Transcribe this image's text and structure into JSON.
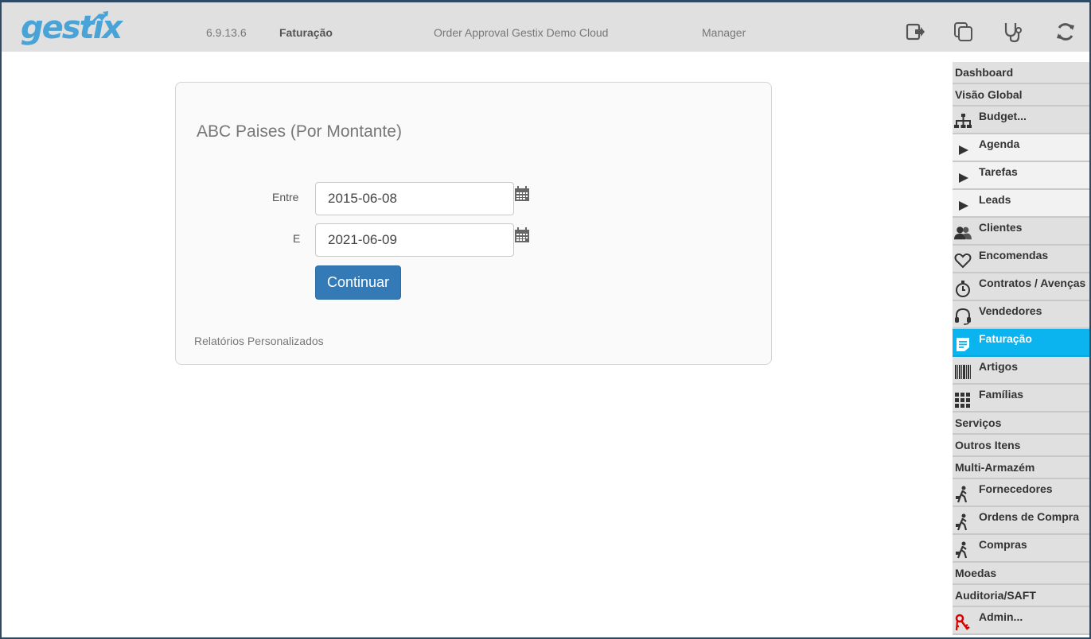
{
  "header": {
    "logo_text": "gestix",
    "version": "6.9.13.6",
    "module": "Faturação",
    "company": "Order Approval Gestix Demo Cloud",
    "role": "Manager",
    "icons": [
      "logout-icon",
      "copy-icon",
      "stethoscope-icon",
      "refresh-icon"
    ]
  },
  "report": {
    "title": "ABC Paises (Por Montante)",
    "from_label": "Entre",
    "from_value": "2015-06-08",
    "to_label": "E",
    "to_value": "2021-06-09",
    "submit_label": "Continuar",
    "footer_link": "Relatórios Personalizados"
  },
  "sidebar": {
    "items": [
      {
        "label": "Dashboard",
        "icon": ""
      },
      {
        "label": "Visão Global",
        "icon": ""
      },
      {
        "label": "Budget...",
        "icon": "org-chart-icon"
      },
      {
        "label": "Agenda",
        "icon": "play-icon"
      },
      {
        "label": "Tarefas",
        "icon": "play-icon"
      },
      {
        "label": "Leads",
        "icon": "play-icon"
      },
      {
        "label": "Clientes",
        "icon": "users-icon"
      },
      {
        "label": "Encomendas",
        "icon": "heart-icon"
      },
      {
        "label": "Contratos / Avenças",
        "icon": "stopwatch-icon"
      },
      {
        "label": "Vendedores",
        "icon": "headset-icon"
      },
      {
        "label": "Faturação",
        "icon": "invoice-icon"
      },
      {
        "label": "Artigos",
        "icon": "barcode-icon"
      },
      {
        "label": "Famílias",
        "icon": "grid-icon"
      },
      {
        "label": "Serviços",
        "icon": ""
      },
      {
        "label": "Outros Itens",
        "icon": ""
      },
      {
        "label": "Multi-Armazém",
        "icon": ""
      },
      {
        "label": "Fornecedores",
        "icon": "walker-icon"
      },
      {
        "label": "Ordens de Compra",
        "icon": "walker-icon"
      },
      {
        "label": "Compras",
        "icon": "walker-icon"
      },
      {
        "label": "Moedas",
        "icon": ""
      },
      {
        "label": "Auditoria/SAFT",
        "icon": ""
      },
      {
        "label": "Admin...",
        "icon": "keys-icon"
      }
    ],
    "active": "Faturação",
    "active_color": "#0bb4ef"
  },
  "colors": {
    "header_bg": "#e0e0e0",
    "primary_button": "#337ab7",
    "logo": "#4aa3d6"
  }
}
